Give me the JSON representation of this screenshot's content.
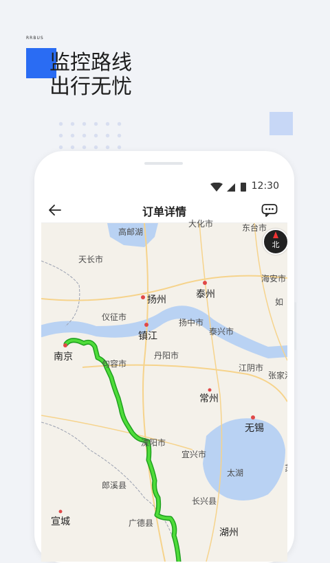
{
  "brand": "RRBUS",
  "headline": {
    "line1": "监控路线",
    "line2": "出行无忧"
  },
  "status": {
    "time": "12:30"
  },
  "titlebar": {
    "title": "订单详情"
  },
  "compass": {
    "label": "北"
  },
  "map_labels": {
    "gaoyouhu": "高邮湖",
    "dongtai": "东台市",
    "tianchang": "天长市",
    "haian": "海安市",
    "yangzhou": "扬州",
    "taizhou": "泰州",
    "rugao": "如",
    "yizheng": "仪征市",
    "yangzhongshi": "扬中市",
    "zhenjiang": "镇江",
    "taixing": "泰兴市",
    "danyang": "丹阳市",
    "nanjing": "南京",
    "jurong": "句容市",
    "jiangyin": "江阴市",
    "zhangjiagang": "张家港",
    "changzhou": "常州",
    "wuxi": "无锡",
    "liyang": "溧阳市",
    "yixing": "宜兴市",
    "taihu": "太湖",
    "langxi": "郎溪县",
    "changxing": "长兴县",
    "xuancheng": "宣城",
    "guangde": "广德县",
    "huzhou": "湖州",
    "su": "苏",
    "ahua": "大化市"
  },
  "colors": {
    "accent": "#2a6cf3",
    "route": "#3ccc2f",
    "water": "#b9d2f3"
  }
}
